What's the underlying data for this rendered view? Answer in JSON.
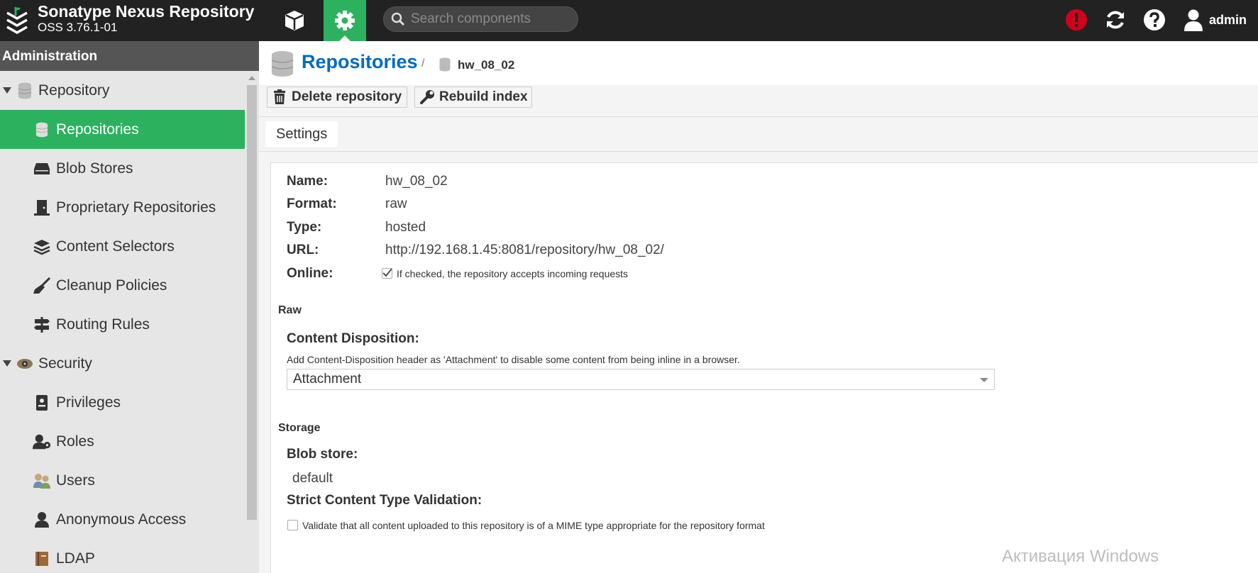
{
  "header": {
    "app_title": "Sonatype Nexus Repository",
    "app_version": "OSS 3.76.1-01",
    "search_placeholder": "Search components",
    "user_name": "admin",
    "accent_color": "#2cb25f",
    "alert_color": "#d0021b",
    "icons": [
      "browse-cube-icon",
      "admin-gear-icon",
      "search-icon",
      "alert-icon",
      "refresh-icon",
      "help-icon",
      "user-icon"
    ]
  },
  "sidebar": {
    "title": "Administration",
    "items": [
      {
        "label": "Repository",
        "kind": "group",
        "icon": "database-icon"
      },
      {
        "label": "Repositories",
        "kind": "child",
        "icon": "database-icon",
        "active": true
      },
      {
        "label": "Blob Stores",
        "kind": "child",
        "icon": "hdd-icon"
      },
      {
        "label": "Proprietary Repositories",
        "kind": "child",
        "icon": "door-icon"
      },
      {
        "label": "Content Selectors",
        "kind": "child",
        "icon": "layers-icon"
      },
      {
        "label": "Cleanup Policies",
        "kind": "child",
        "icon": "broom-icon"
      },
      {
        "label": "Routing Rules",
        "kind": "child",
        "icon": "signpost-icon"
      },
      {
        "label": "Security",
        "kind": "group",
        "icon": "security-icon"
      },
      {
        "label": "Privileges",
        "kind": "child",
        "icon": "badge-icon"
      },
      {
        "label": "Roles",
        "kind": "child",
        "icon": "user-role-icon"
      },
      {
        "label": "Users",
        "kind": "child",
        "icon": "users-icon"
      },
      {
        "label": "Anonymous Access",
        "kind": "child",
        "icon": "user-icon"
      },
      {
        "label": "LDAP",
        "kind": "child",
        "icon": "book-icon"
      }
    ]
  },
  "breadcrumb": {
    "root": "Repositories",
    "separator": "/",
    "leaf": "hw_08_02"
  },
  "toolbar": {
    "delete_label": "Delete repository",
    "rebuild_label": "Rebuild index"
  },
  "tabs": [
    {
      "label": "Settings"
    }
  ],
  "form": {
    "name_label": "Name:",
    "name_value": "hw_08_02",
    "format_label": "Format:",
    "format_value": "raw",
    "type_label": "Type:",
    "type_value": "hosted",
    "url_label": "URL:",
    "url_value": "http://192.168.1.45:8081/repository/hw_08_02/",
    "online_label": "Online:",
    "online_checked": true,
    "online_help": "If checked, the repository accepts incoming requests",
    "raw_section": "Raw",
    "content_disposition_label": "Content Disposition:",
    "content_disposition_help": "Add Content-Disposition header as 'Attachment' to disable some content from being inline in a browser.",
    "content_disposition_value": "Attachment",
    "storage_section": "Storage",
    "blob_store_label": "Blob store:",
    "blob_store_value": "default",
    "strict_label": "Strict Content Type Validation:",
    "strict_checked": false,
    "strict_help": "Validate that all content uploaded to this repository is of a MIME type appropriate for the repository format"
  },
  "watermark": "Активация Windows"
}
